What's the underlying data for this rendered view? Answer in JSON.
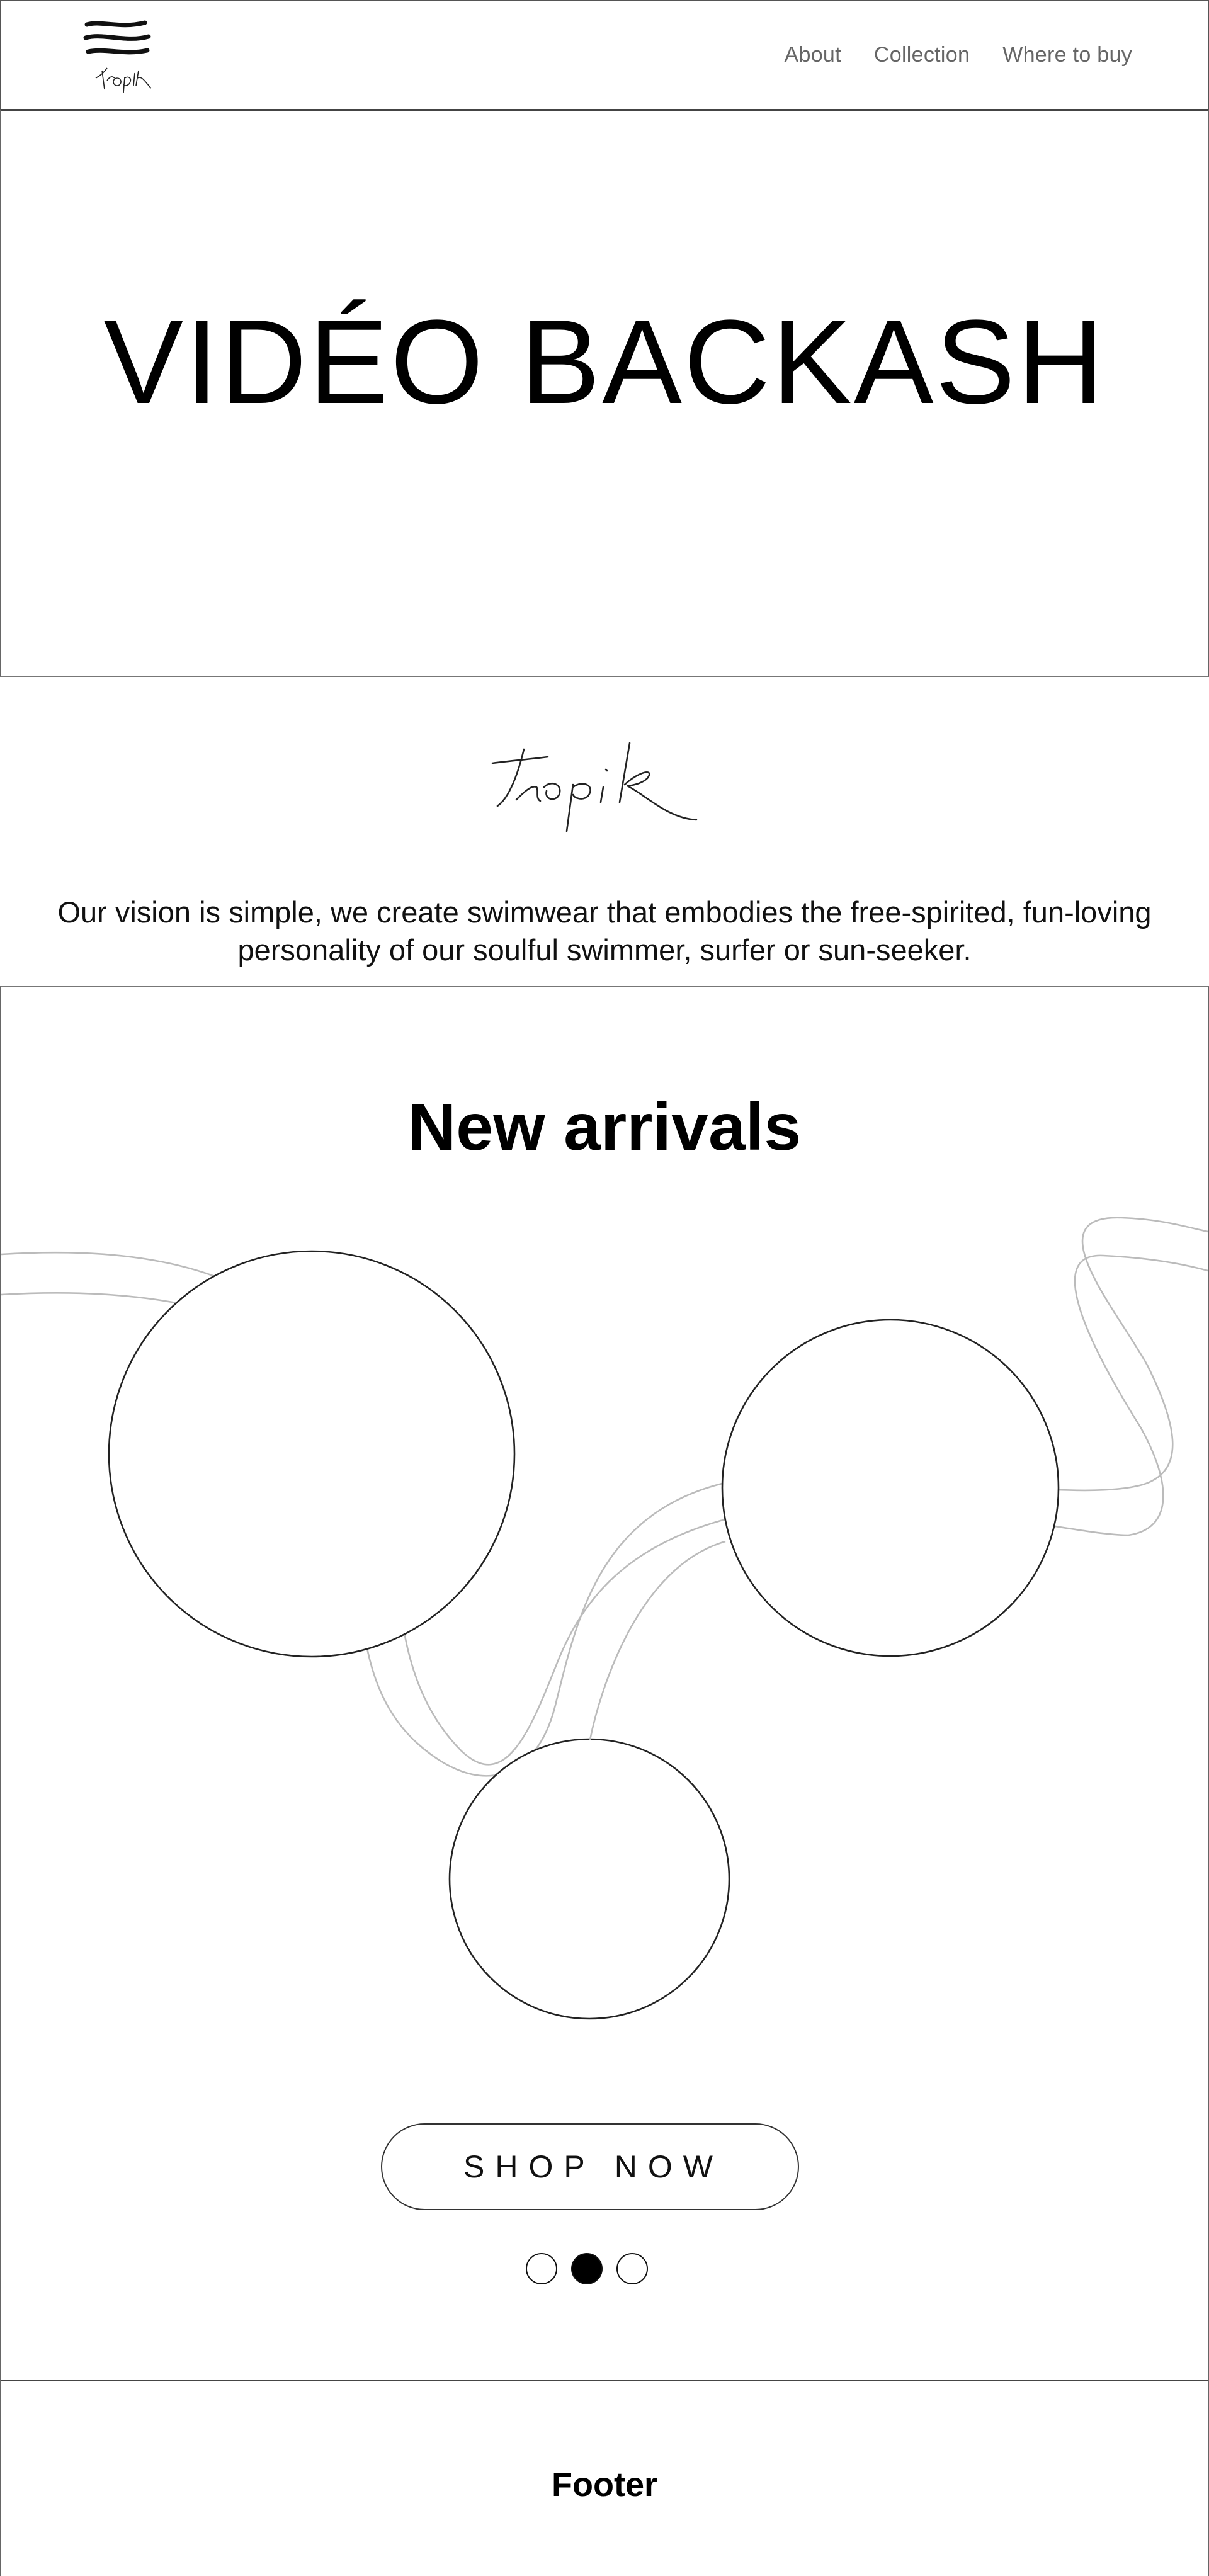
{
  "header": {
    "logo_text": "tropik",
    "nav": [
      {
        "label": "About"
      },
      {
        "label": "Collection"
      },
      {
        "label": "Where to buy"
      }
    ]
  },
  "hero": {
    "title": "VIDÉO BACKASH"
  },
  "intro": {
    "logo_text": "tropik",
    "text": "Our vision is simple, we create swimwear that embodies the free-spirited, fun-loving personality of our soulful swimmer, surfer or sun-seeker."
  },
  "arrivals": {
    "title": "New arrivals",
    "shop_label": "SHOP NOW",
    "carousel": {
      "count": 3,
      "active": 2
    }
  },
  "footer": {
    "title": "Footer"
  },
  "colors": {
    "text": "#000000",
    "nav_text": "#666666",
    "border": "#555555",
    "curve": "#bbbbbb"
  }
}
